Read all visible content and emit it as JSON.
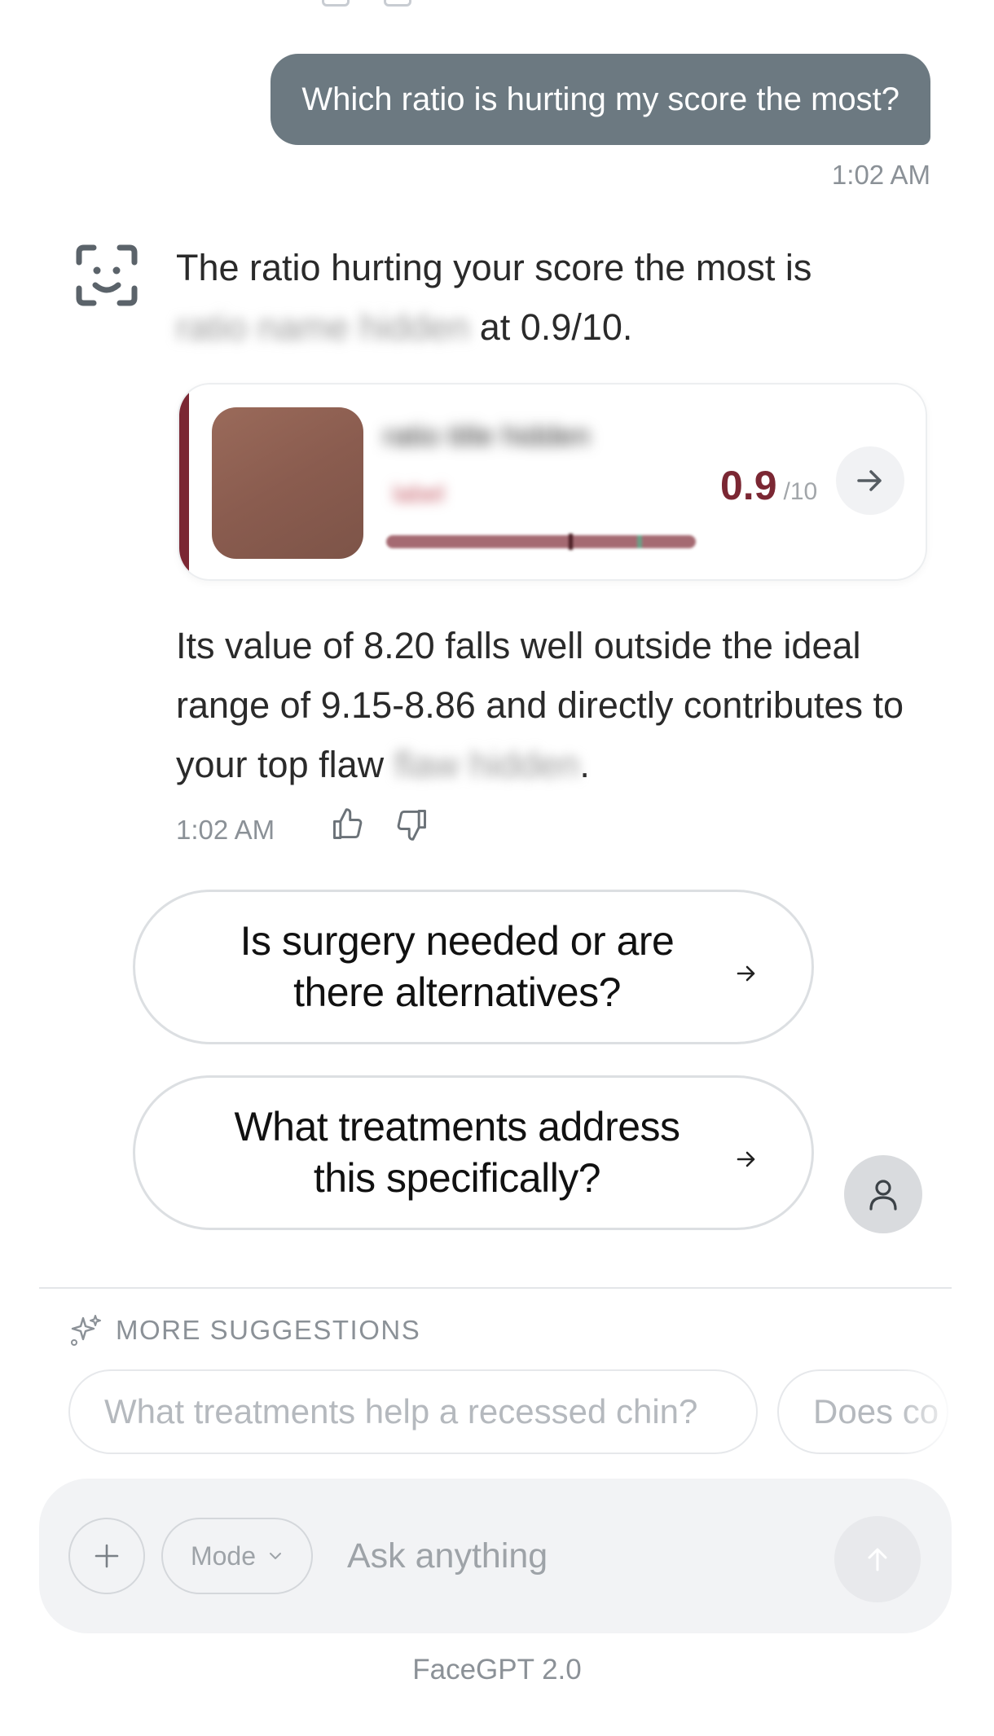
{
  "conversation": {
    "user_message": "Which ratio is hurting my score the most?",
    "user_timestamp": "1:02 AM",
    "bot_intro": "The ratio hurting your score the most is",
    "bot_ratio_name_redacted": "ratio name hidden",
    "bot_intro_suffix": " at 0.9/10.",
    "ratio_card": {
      "title_redacted": "ratio title hidden",
      "subtitle_redacted": "label",
      "score": "0.9",
      "score_max": "/10",
      "score_fraction": 0.09,
      "accent_color": "#7b2733"
    },
    "bot_followup_prefix": "Its value of 8.20 falls well outside the ideal range of 9.15-8.86 and directly contributes to your top flaw ",
    "bot_flaw_redacted": "flaw hidden",
    "bot_followup_suffix": ".",
    "bot_timestamp": "1:02 AM"
  },
  "suggestions": [
    "Is surgery needed or are there alternatives?",
    "What treatments address this specifically?"
  ],
  "more_suggestions": {
    "heading": "MORE SUGGESTIONS",
    "chips": [
      "What treatments help a recessed chin?",
      "Does co"
    ]
  },
  "composer": {
    "mode_label": "Mode",
    "placeholder": "Ask anything"
  },
  "footer": "FaceGPT 2.0",
  "icons": {
    "bot": "face-scan-icon",
    "like": "thumbs-up-icon",
    "dislike": "thumbs-down-icon",
    "card_arrow": "arrow-right-icon",
    "profile": "user-icon",
    "sparkle": "sparkle-icon",
    "plus": "plus-icon",
    "send": "arrow-up-icon"
  }
}
